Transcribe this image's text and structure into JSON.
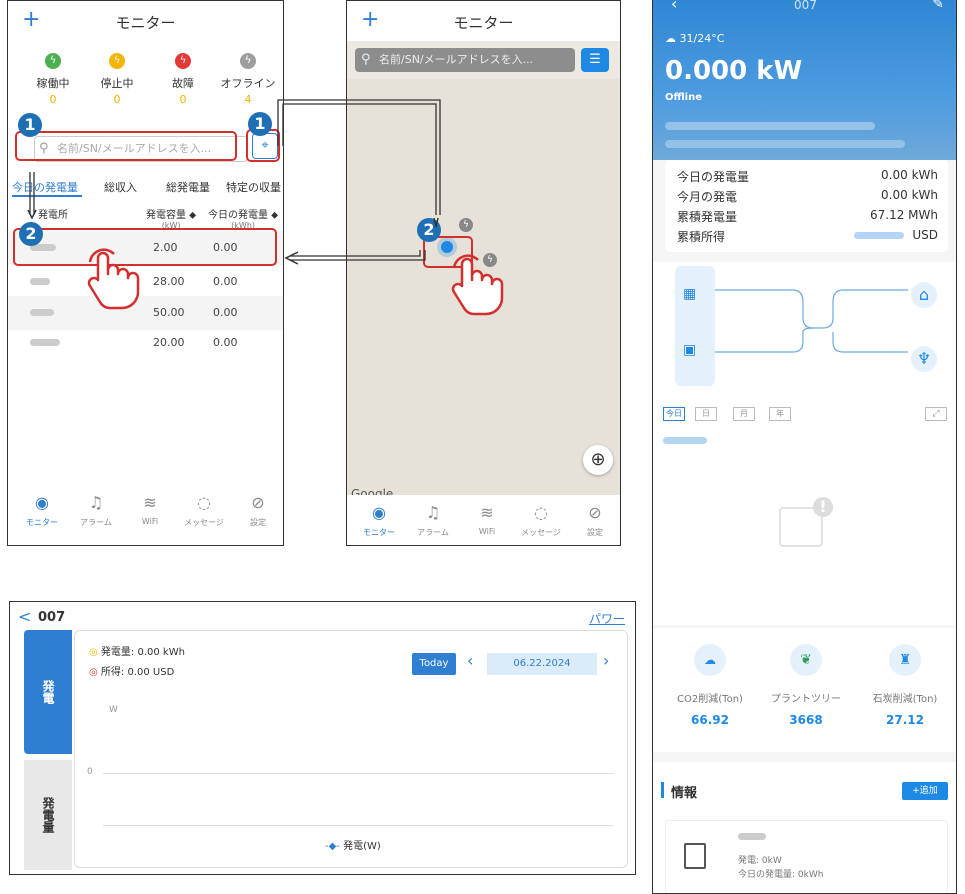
{
  "panel1": {
    "title": "モニター",
    "plus": "+",
    "statuses": [
      {
        "label": "稼働中",
        "count": "0",
        "color": "#4caf50",
        "icon_name": "lightning-icon"
      },
      {
        "label": "停止中",
        "count": "0",
        "color": "#f4b400",
        "icon_name": "lightning-icon"
      },
      {
        "label": "故障",
        "count": "0",
        "color": "#e53935",
        "icon_name": "lightning-icon"
      },
      {
        "label": "オフライン",
        "count": "4",
        "color": "#9e9e9e",
        "icon_name": "lightning-icon"
      }
    ],
    "search_placeholder": "名前/SN/メールアドレスを入...",
    "tabs": [
      "今日の発電量",
      "総収入",
      "総発電量",
      "特定の収量"
    ],
    "columns": {
      "plant": "発電所",
      "capacity": "発電容量 ⬥",
      "capacity_unit": "(kW)",
      "today": "今日の発電量 ⬥",
      "today_unit": "(kWh)"
    },
    "rows": [
      {
        "capacity": "2.00",
        "today": "0.00"
      },
      {
        "capacity": "28.00",
        "today": "0.00"
      },
      {
        "capacity": "50.00",
        "today": "0.00"
      },
      {
        "capacity": "20.00",
        "today": "0.00"
      }
    ],
    "tabbar": [
      "モニター",
      "アラーム",
      "WiFi",
      "メッセージ",
      "設定"
    ]
  },
  "panel2": {
    "title": "モニター",
    "plus": "+",
    "search_placeholder": "名前/SN/メールアドレスを入...",
    "google": "Google",
    "tabbar": [
      "モニター",
      "アラーム",
      "WiFi",
      "メッセージ",
      "設定"
    ]
  },
  "markers": {
    "one": "1",
    "two": "2"
  },
  "panel3": {
    "back": "<",
    "name": "007",
    "power_tab": "パワー",
    "side_tab_active": "発電",
    "side_tab_inactive": "発電量",
    "gen_label": "発電量: 0.00 kWh",
    "income_label": "所得: 0.00 USD",
    "today_btn": "Today",
    "date": "06.22.2024",
    "y_unit": "W",
    "y_zero": "0",
    "legend": "発電(W)"
  },
  "panel4": {
    "title": "007",
    "weather": "31/24°C",
    "power": "0.000 kW",
    "status": "Offline",
    "stats": [
      {
        "label": "今日の発電量",
        "value": "0.00 kWh"
      },
      {
        "label": "今月の発電",
        "value": "0.00 kWh"
      },
      {
        "label": "累積発電量",
        "value": "67.12 MWh"
      },
      {
        "label": "累積所得",
        "value": "USD"
      }
    ],
    "period_tabs": [
      "今日",
      "日",
      "月",
      "年"
    ],
    "env": [
      {
        "label": "CO2削減(Ton)",
        "value": "66.92",
        "icon_name": "cloud-co2-icon"
      },
      {
        "label": "プラントツリー",
        "value": "3668",
        "icon_name": "sprout-icon"
      },
      {
        "label": "石炭削減(Ton)",
        "value": "27.12",
        "icon_name": "factory-icon"
      }
    ],
    "info_title": "情報",
    "add_btn": "+追加",
    "device_power": "発電: 0kW",
    "device_today": "今日の発電量: 0kWh"
  }
}
